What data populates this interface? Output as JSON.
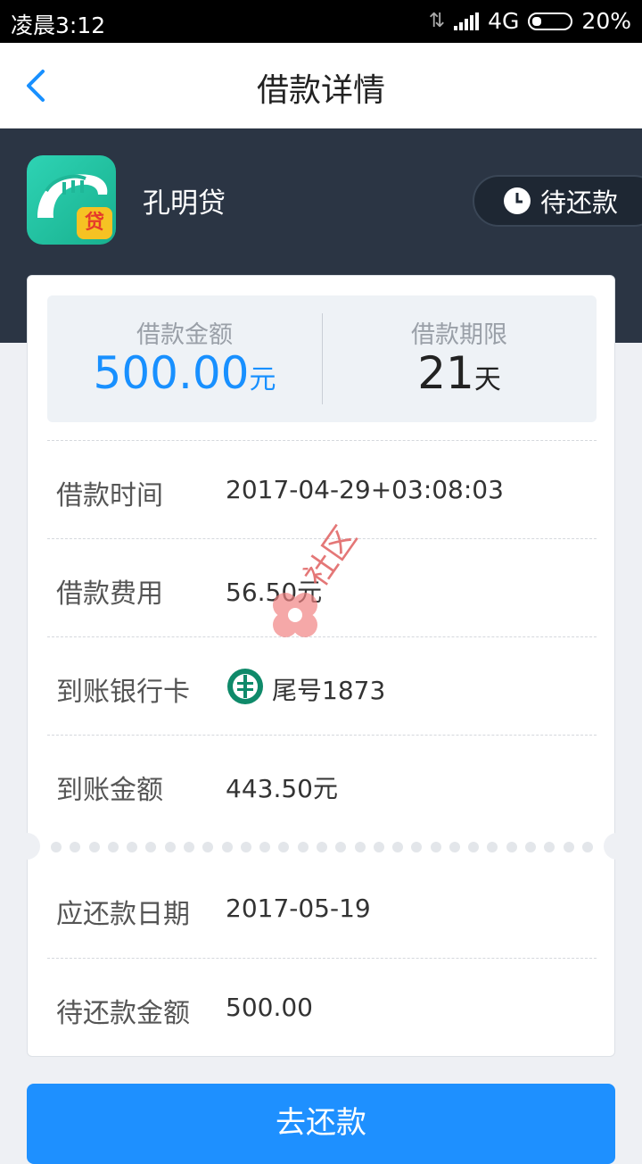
{
  "status_bar": {
    "time": "凌晨3:12",
    "network": "4G",
    "battery": "20%"
  },
  "header": {
    "title": "借款详情"
  },
  "app": {
    "name": "孔明贷",
    "logo_badge": "贷",
    "status": "待还款"
  },
  "summary": {
    "amount_label": "借款金额",
    "amount_value": "500.00",
    "amount_unit": "元",
    "term_label": "借款期限",
    "term_value": "21",
    "term_unit": "天"
  },
  "details": [
    {
      "label": "借款时间",
      "value": "2017-04-29+03:08:03"
    },
    {
      "label": "借款费用",
      "value": "56.50元"
    },
    {
      "label": "到账银行卡",
      "value": "尾号1873"
    },
    {
      "label": "到账金额",
      "value": "443.50元"
    }
  ],
  "repayment": [
    {
      "label": "应还款日期",
      "value": "2017-05-19"
    },
    {
      "label": "待还款金额",
      "value": "500.00"
    }
  ],
  "actions": {
    "repay_button": "去还款"
  },
  "watermark": {
    "text": "社区"
  },
  "colors": {
    "accent": "#1890ff",
    "hero_bg": "#2b3544",
    "button": "#1e90ff"
  }
}
